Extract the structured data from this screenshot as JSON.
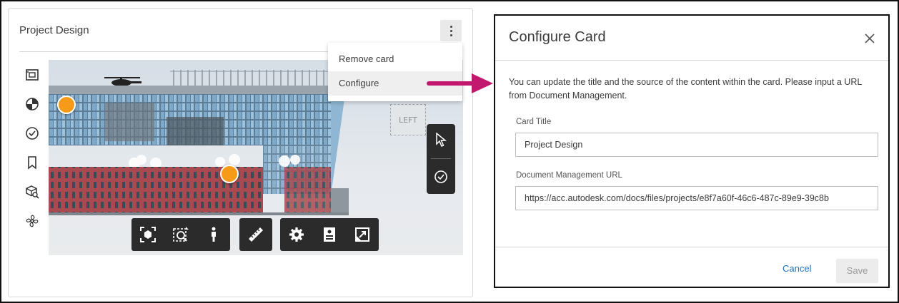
{
  "card": {
    "title": "Project Design",
    "side_tools": [
      "sheet-icon",
      "model-browser-icon",
      "check-circle-icon",
      "bookmark-icon",
      "cube-search-icon",
      "fan-icon"
    ],
    "viewcube_label": "LEFT",
    "toolbar": [
      [
        "focus-icon",
        "zoom-window-icon",
        "walk-icon"
      ],
      [
        "measure-icon"
      ],
      [
        "settings-icon",
        "properties-icon",
        "fullscreen-icon"
      ]
    ]
  },
  "menu": {
    "items": [
      "Remove card",
      "Configure"
    ],
    "active_index": 1
  },
  "dialog": {
    "title": "Configure Card",
    "description": "You can update the title and the source of the content within the card. Please input a URL from Document Management.",
    "card_title_label": "Card Title",
    "card_title_value": "Project Design",
    "url_label": "Document Management URL",
    "url_value": "https://acc.autodesk.com/docs/files/projects/e8f7a60f-46c6-487c-89e9-39c8b",
    "cancel_label": "Cancel",
    "save_label": "Save"
  },
  "colors": {
    "accent_link": "#1d6fb8",
    "arrow": "#c2186d",
    "marker": "#f59b18"
  }
}
